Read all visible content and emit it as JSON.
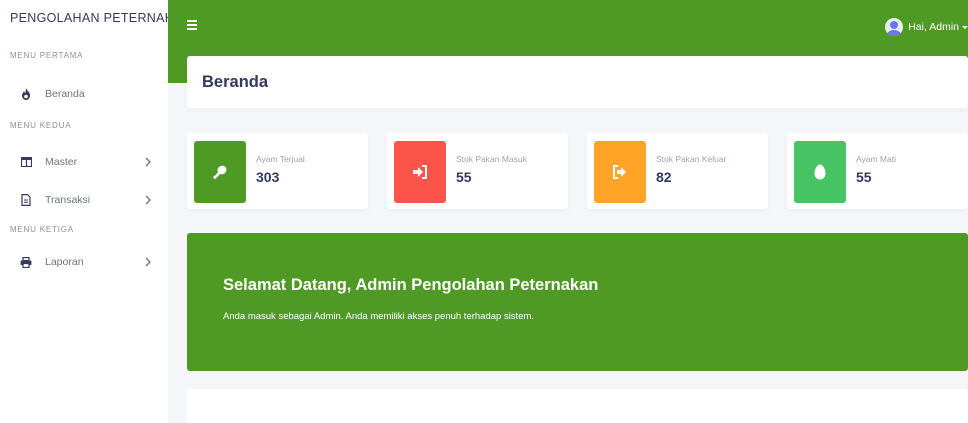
{
  "sidebar": {
    "brand": "PENGOLAHAN PETERNAKAN",
    "sections": [
      {
        "header": "MENU PERTAMA",
        "items": [
          {
            "label": "Beranda",
            "icon": "fire-icon",
            "has_submenu": false
          }
        ]
      },
      {
        "header": "MENU KEDUA",
        "items": [
          {
            "label": "Master",
            "icon": "columns-icon",
            "has_submenu": true
          },
          {
            "label": "Transaksi",
            "icon": "file-icon",
            "has_submenu": true
          }
        ]
      },
      {
        "header": "MENU KETIGA",
        "items": [
          {
            "label": "Laporan",
            "icon": "print-icon",
            "has_submenu": true
          }
        ]
      }
    ]
  },
  "topbar": {
    "user_label": "Hai, Admin",
    "menu_icon": "hamburger-icon"
  },
  "page": {
    "title": "Beranda"
  },
  "stats": [
    {
      "label": "Ayam Terjual",
      "value": "303",
      "icon": "drumstick-icon",
      "color": "#4f9a24"
    },
    {
      "label": "Stok Pakan Masuk",
      "value": "55",
      "icon": "sign-in-icon",
      "color": "#fc544b"
    },
    {
      "label": "Stok Pakan Keluar",
      "value": "82",
      "icon": "sign-out-icon",
      "color": "#ffa426"
    },
    {
      "label": "Ayam Mati",
      "value": "55",
      "icon": "egg-icon",
      "color": "#47c363"
    }
  ],
  "welcome": {
    "title": "Selamat Datang, Admin Pengolahan Peternakan",
    "message": "Anda masuk sebagai Admin. Anda memiliki akses penuh terhadap sistem."
  },
  "colors": {
    "primary": "#4f9a24",
    "background": "#f4f6f9",
    "text": "#34395e"
  }
}
